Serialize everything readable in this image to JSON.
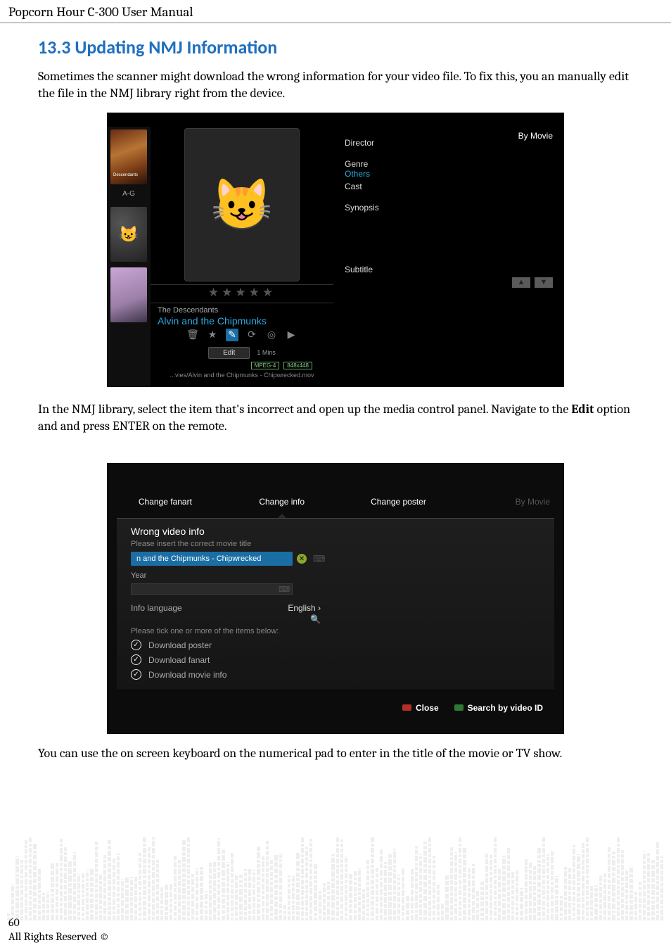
{
  "header": {
    "title": "Popcorn Hour C-300 User Manual"
  },
  "section": {
    "heading": "13.3 Updating NMJ Information"
  },
  "para1": "Sometimes the scanner might download the wrong information for your video file. To fix this, you an manually edit the file in the NMJ library right from the device.",
  "para2_pre": "In the NMJ library, select the item that's incorrect and open up the media control panel. Navigate to the ",
  "para2_bold": "Edit",
  "para2_post": " option and and press ENTER on the remote.",
  "para3": "You can use the on screen keyboard on the numerical pad to enter in the title of the movie or TV show.",
  "footer": {
    "page": "60",
    "copyright": "All Rights Reserved ©"
  },
  "shot1": {
    "by_movie": "By Movie",
    "side_chip": "A-G",
    "stars": "★★★★★",
    "prev_title": "The Descendants",
    "sel_title": "Alvin and the Chipmunks",
    "edit": "Edit",
    "duration": "1 Mins",
    "badge1": "MPEG-4",
    "badge2": "848x448",
    "filepath": "...vies/Alvin and the Chipmunks - Chipwrecked.mov",
    "meta": {
      "director": "Director",
      "genre": "Genre",
      "genre_val": "Others",
      "cast": "Cast",
      "synopsis": "Synopsis",
      "subtitle": "Subtitle"
    },
    "nav_up": "▲",
    "nav_dn": "▼",
    "icons": {
      "trash": "🗑",
      "star": "★",
      "edit": "✎",
      "refresh": "⟳",
      "disc": "◎",
      "play": "▶"
    }
  },
  "shot2": {
    "tabs": {
      "fanart": "Change fanart",
      "info": "Change info",
      "poster": "Change poster",
      "by": "By Movie"
    },
    "header": "Wrong video info",
    "sub1": "Please insert the correct movie title",
    "title_input": "n and the Chipmunks - Chipwrecked",
    "year_label": "Year",
    "lang_label": "Info language",
    "lang_value": "English  ›",
    "sub2": "Please tick one or more of the items below:",
    "check1": "Download poster",
    "check2": "Download fanart",
    "check3": "Download movie info",
    "close": "Close",
    "search": "Search by video ID",
    "clear": "✕",
    "kb": "⌨",
    "mag": "🔍",
    "tick": "✓"
  }
}
